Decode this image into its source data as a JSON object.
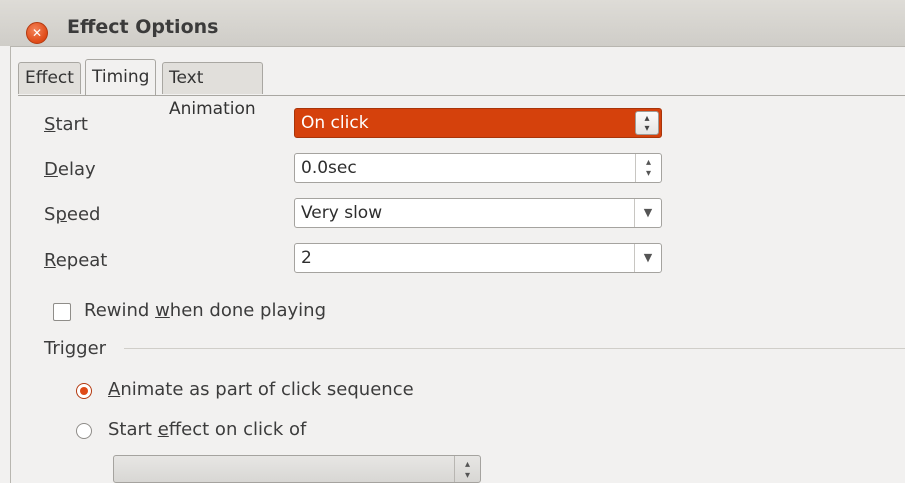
{
  "window": {
    "title": "Effect Options"
  },
  "tabs": [
    {
      "label": "Effect"
    },
    {
      "label": "Timing"
    },
    {
      "label": "Text Animation"
    }
  ],
  "timing": {
    "start": {
      "label_mn": "S",
      "label_rest": "tart",
      "value": "On click"
    },
    "delay": {
      "label_mn": "D",
      "label_rest": "elay",
      "value": "0.0sec"
    },
    "speed": {
      "label_pre": "S",
      "label_mn": "p",
      "label_rest": "eed",
      "value": "Very slow"
    },
    "repeat": {
      "label_mn": "R",
      "label_rest": "epeat",
      "value": "2"
    },
    "rewind": {
      "label_pre": "Rewind ",
      "label_mn": "w",
      "label_rest": "hen done playing",
      "checked": false
    }
  },
  "trigger": {
    "heading": "Trigger",
    "option1": {
      "label_mn": "A",
      "label_rest": "nimate as part of click sequence",
      "selected": true
    },
    "option2": {
      "label_pre": "Start ",
      "label_mn": "e",
      "label_rest": "ffect on click of",
      "selected": false
    },
    "shape_value": ""
  },
  "colors": {
    "accent": "#d5410c",
    "close_button": "#df4a17"
  }
}
